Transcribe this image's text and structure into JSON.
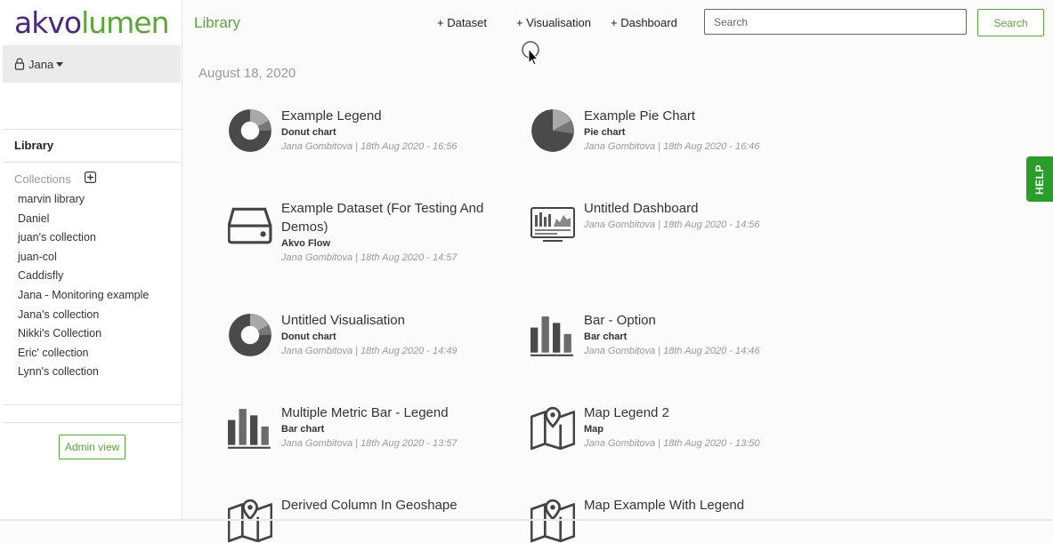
{
  "brand": {
    "part1": "akvo",
    "part2": "lumen"
  },
  "user": {
    "name": "Jana"
  },
  "sidebar": {
    "library_label": "Library",
    "collections_label": "Collections",
    "collections": [
      "marvin library",
      "Daniel",
      "juan's collection",
      "juan-col",
      "Caddisfly",
      "Jana - Monitoring example",
      "Jana's collection",
      "Nikki's Collection",
      "Eric' collection",
      "Lynn's collection"
    ],
    "admin_button": "Admin view"
  },
  "header": {
    "title": "Library",
    "nav": [
      "+ Dataset",
      "+ Visualisation",
      "+ Dashboard"
    ],
    "search_placeholder": "Search",
    "search_button": "Search"
  },
  "library": {
    "date_heading": "August 18, 2020",
    "items": [
      {
        "icon": "donut-chart-icon",
        "title": "Example Legend",
        "type": "Donut chart",
        "meta": "Jana Gombitova | 18th Aug 2020 - 16:56"
      },
      {
        "icon": "pie-chart-icon",
        "title": "Example Pie Chart",
        "type": "Pie chart",
        "meta": "Jana Gombitova | 18th Aug 2020 - 16:46"
      },
      {
        "icon": "dataset-icon",
        "title": "Example Dataset (For Testing And Demos)",
        "type": "Akvo Flow",
        "meta": "Jana Gombitova | 18th Aug 2020 - 14:57"
      },
      {
        "icon": "dashboard-icon",
        "title": "Untitled Dashboard",
        "type": "",
        "meta": "Jana Gombitova | 18th Aug 2020 - 14:56"
      },
      {
        "icon": "donut-chart-icon",
        "title": "Untitled Visualisation",
        "type": "Donut chart",
        "meta": "Jana Gombitova | 18th Aug 2020 - 14:49"
      },
      {
        "icon": "bar-chart-icon",
        "title": "Bar - Option",
        "type": "Bar chart",
        "meta": "Jana Gombitova | 18th Aug 2020 - 14:46"
      },
      {
        "icon": "bar-chart-icon",
        "title": "Multiple Metric Bar - Legend",
        "type": "Bar chart",
        "meta": "Jana Gombitova | 18th Aug 2020 - 13:57"
      },
      {
        "icon": "map-icon",
        "title": "Map Legend 2",
        "type": "Map",
        "meta": "Jana Gombitova | 18th Aug 2020 - 13:50"
      },
      {
        "icon": "map-icon",
        "title": "Derived Column In Geoshape",
        "type": "",
        "meta": ""
      },
      {
        "icon": "map-icon",
        "title": "Map Example With Legend",
        "type": "",
        "meta": ""
      }
    ]
  },
  "help": {
    "label": "HELP"
  },
  "colors": {
    "brand_purple": "#4a2a78",
    "brand_green": "#5da43b",
    "help_green": "#2a9d2a"
  }
}
